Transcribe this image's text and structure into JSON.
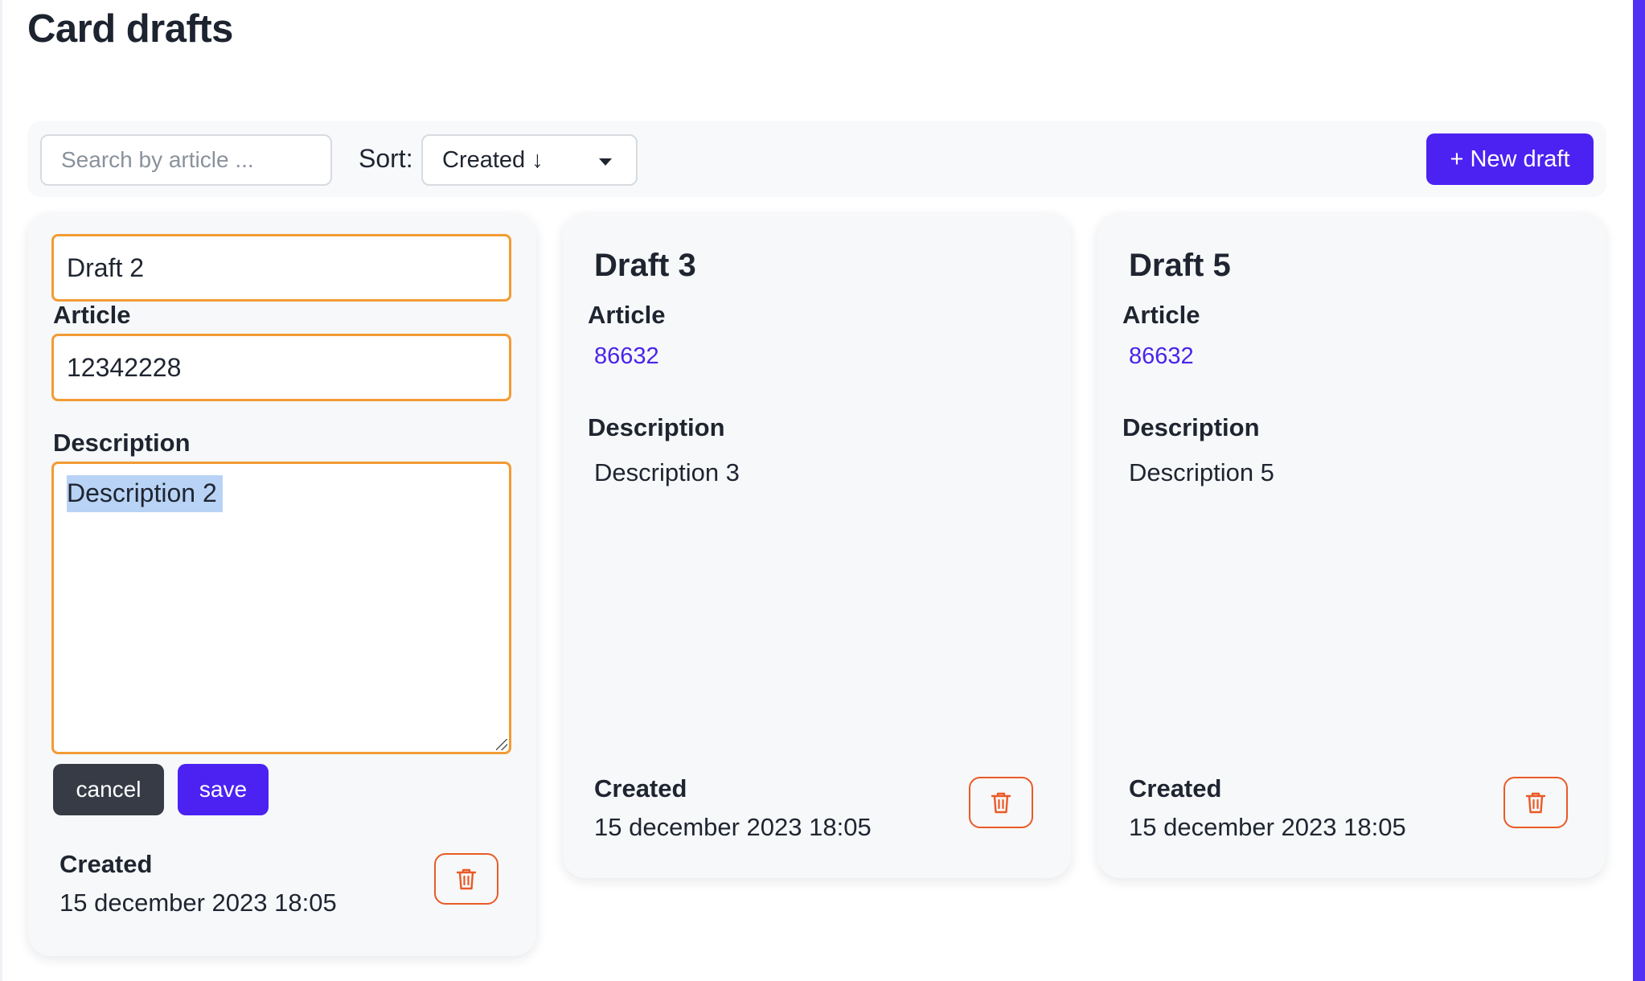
{
  "page": {
    "title": "Card drafts"
  },
  "toolbar": {
    "search_placeholder": "Search by article ...",
    "sort_label": "Sort:",
    "sort_value": "Created ↓",
    "new_draft_label": "+ New draft"
  },
  "colors": {
    "accent": "#4c22f2",
    "edit_border": "#f29b34",
    "delete": "#ea5a27",
    "selection": "#b8d3f5"
  },
  "icons": {
    "delete": "trash-icon",
    "sort_dropdown": "chevron-down-icon"
  },
  "editing_card": {
    "name_value": "Draft 2",
    "article_label": "Article",
    "article_value": "12342228",
    "description_label": "Description",
    "description_value": "Description 2",
    "cancel_label": "cancel",
    "save_label": "save",
    "created_label": "Created",
    "created_value": "15 december 2023 18:05"
  },
  "cards": [
    {
      "title": "Draft 3",
      "article_label": "Article",
      "article_value": "86632",
      "description_label": "Description",
      "description_value": "Description 3",
      "created_label": "Created",
      "created_value": "15 december 2023 18:05"
    },
    {
      "title": "Draft 5",
      "article_label": "Article",
      "article_value": "86632",
      "description_label": "Description",
      "description_value": "Description 5",
      "created_label": "Created",
      "created_value": "15 december 2023 18:05"
    }
  ]
}
